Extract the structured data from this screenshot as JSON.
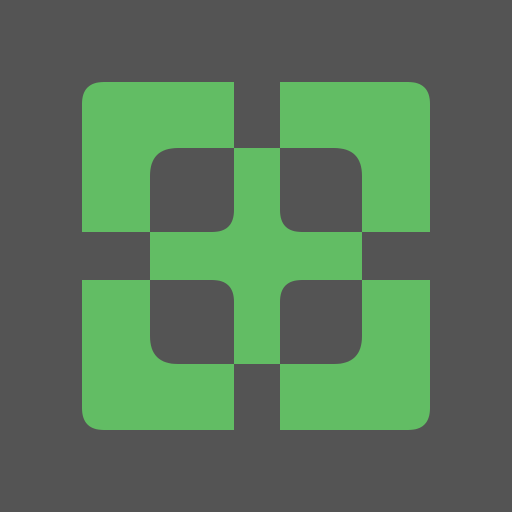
{
  "icon": {
    "name": "grid-cross-logo-icon",
    "background_color": "#545454",
    "foreground_color": "#62bd64"
  }
}
